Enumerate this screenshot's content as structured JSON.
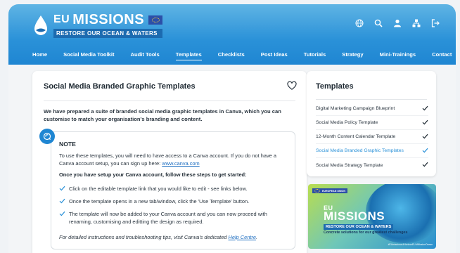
{
  "brand": {
    "eu": "EU",
    "missions": "MISSIONS",
    "subtitle": "RESTORE OUR OCEAN & WATERS",
    "primary_color": "#1f86d2",
    "accent_color": "#2a91d8"
  },
  "header_tools": [
    {
      "name": "language-icon"
    },
    {
      "name": "search-icon"
    },
    {
      "name": "user-icon"
    },
    {
      "name": "sitemap-icon"
    },
    {
      "name": "logout-icon"
    }
  ],
  "nav": {
    "items": [
      {
        "label": "Home"
      },
      {
        "label": "Social Media Toolkit"
      },
      {
        "label": "Audit Tools"
      },
      {
        "label": "Templates"
      },
      {
        "label": "Checklists"
      },
      {
        "label": "Post Ideas"
      },
      {
        "label": "Tutorials"
      },
      {
        "label": "Strategy"
      },
      {
        "label": "Mini-Trainings"
      },
      {
        "label": "Contact"
      }
    ],
    "active": "Templates"
  },
  "main": {
    "title": "Social Media Branded Graphic Templates",
    "intro": "We have prepared a suite of branded social media graphic templates in Canva, which you can customise to match your organisation's branding and content.",
    "note": {
      "title": "NOTE",
      "p1_before": "To use these templates, you will need to have access to a Canva account. If you do not have a Canva account setup, you can sign up here: ",
      "p1_link": "www.canva.com",
      "subheading": "Once you have setup your Canva account, follow these steps to get started:",
      "steps": [
        "Click on the editable template link that you would like to edit - see links below.",
        "Once the template opens in a new tab/window, click the 'Use Template' button.",
        "The template will now be added to your Canva account and you can now proceed with renaming, customising and editting the design as required."
      ],
      "footer_before": "For detailed instructions and troubleshooting tips, visit Canva's dedicated ",
      "footer_link": "Help Centre",
      "footer_after": "."
    }
  },
  "sidebar": {
    "title": "Templates",
    "items": [
      {
        "label": "Digital Marketing Campaign Blueprint"
      },
      {
        "label": "Social Media Policy Template"
      },
      {
        "label": "12-Month Content Calendar Template"
      },
      {
        "label": "Social Media Branded Graphic Templates"
      },
      {
        "label": "Social Media Strategy Template"
      }
    ],
    "current": "Social Media Branded Graphic Templates"
  },
  "banner": {
    "eu_label": "EUROPEAN UNION",
    "eu": "EU",
    "missions": "MISSIONS",
    "subtitle": "RESTORE OUR OCEAN & WATERS",
    "tagline": "Concrete solutions for our greatest challenges",
    "tags": "#EUmissions  #HorizonEU  #MissionOcean"
  }
}
